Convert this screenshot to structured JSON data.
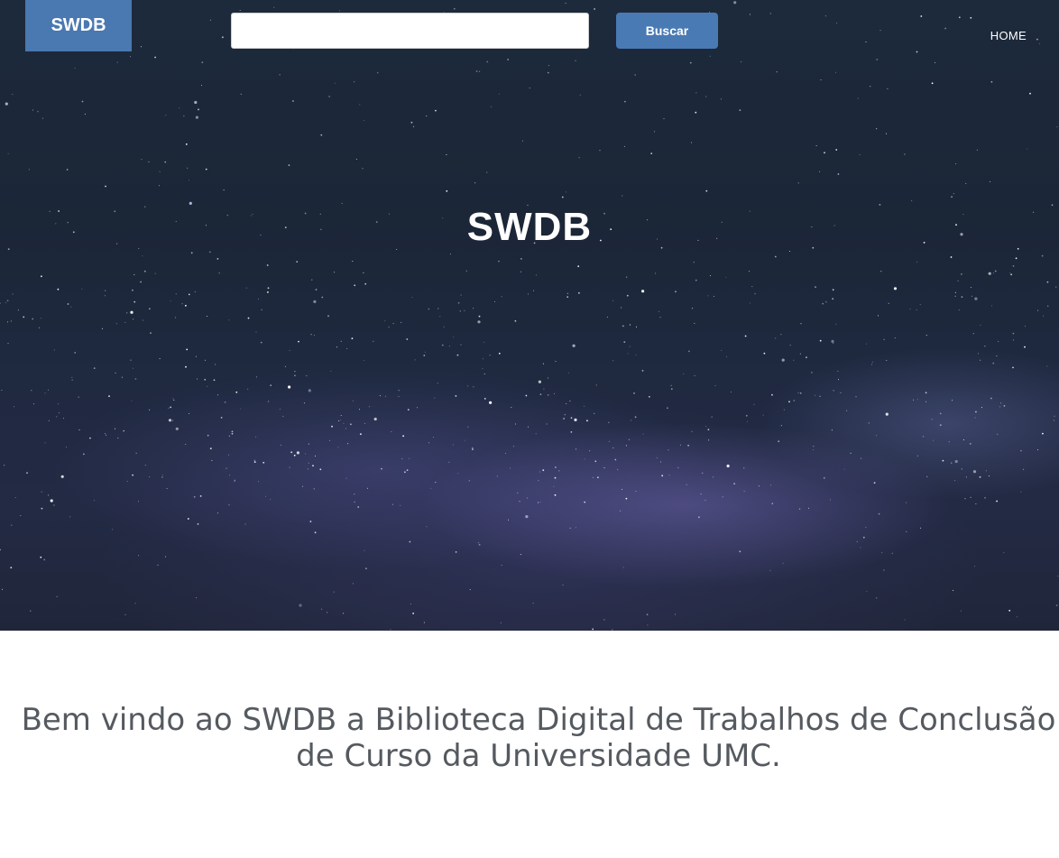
{
  "header": {
    "brand": "SWDB",
    "search": {
      "value": "",
      "placeholder": "",
      "button_label": "Buscar"
    },
    "nav": {
      "home_label": "HOME"
    }
  },
  "hero": {
    "title": "SWDB",
    "background": "starry-night-sky"
  },
  "main": {
    "welcome_text": "Bem vindo ao SWDB a Biblioteca Digital de Trabalhos de Conclusão de Curso da Universidade UMC."
  },
  "colors": {
    "accent": "#4a78b0",
    "text_muted": "#555a60",
    "hero_text": "#ffffff"
  }
}
